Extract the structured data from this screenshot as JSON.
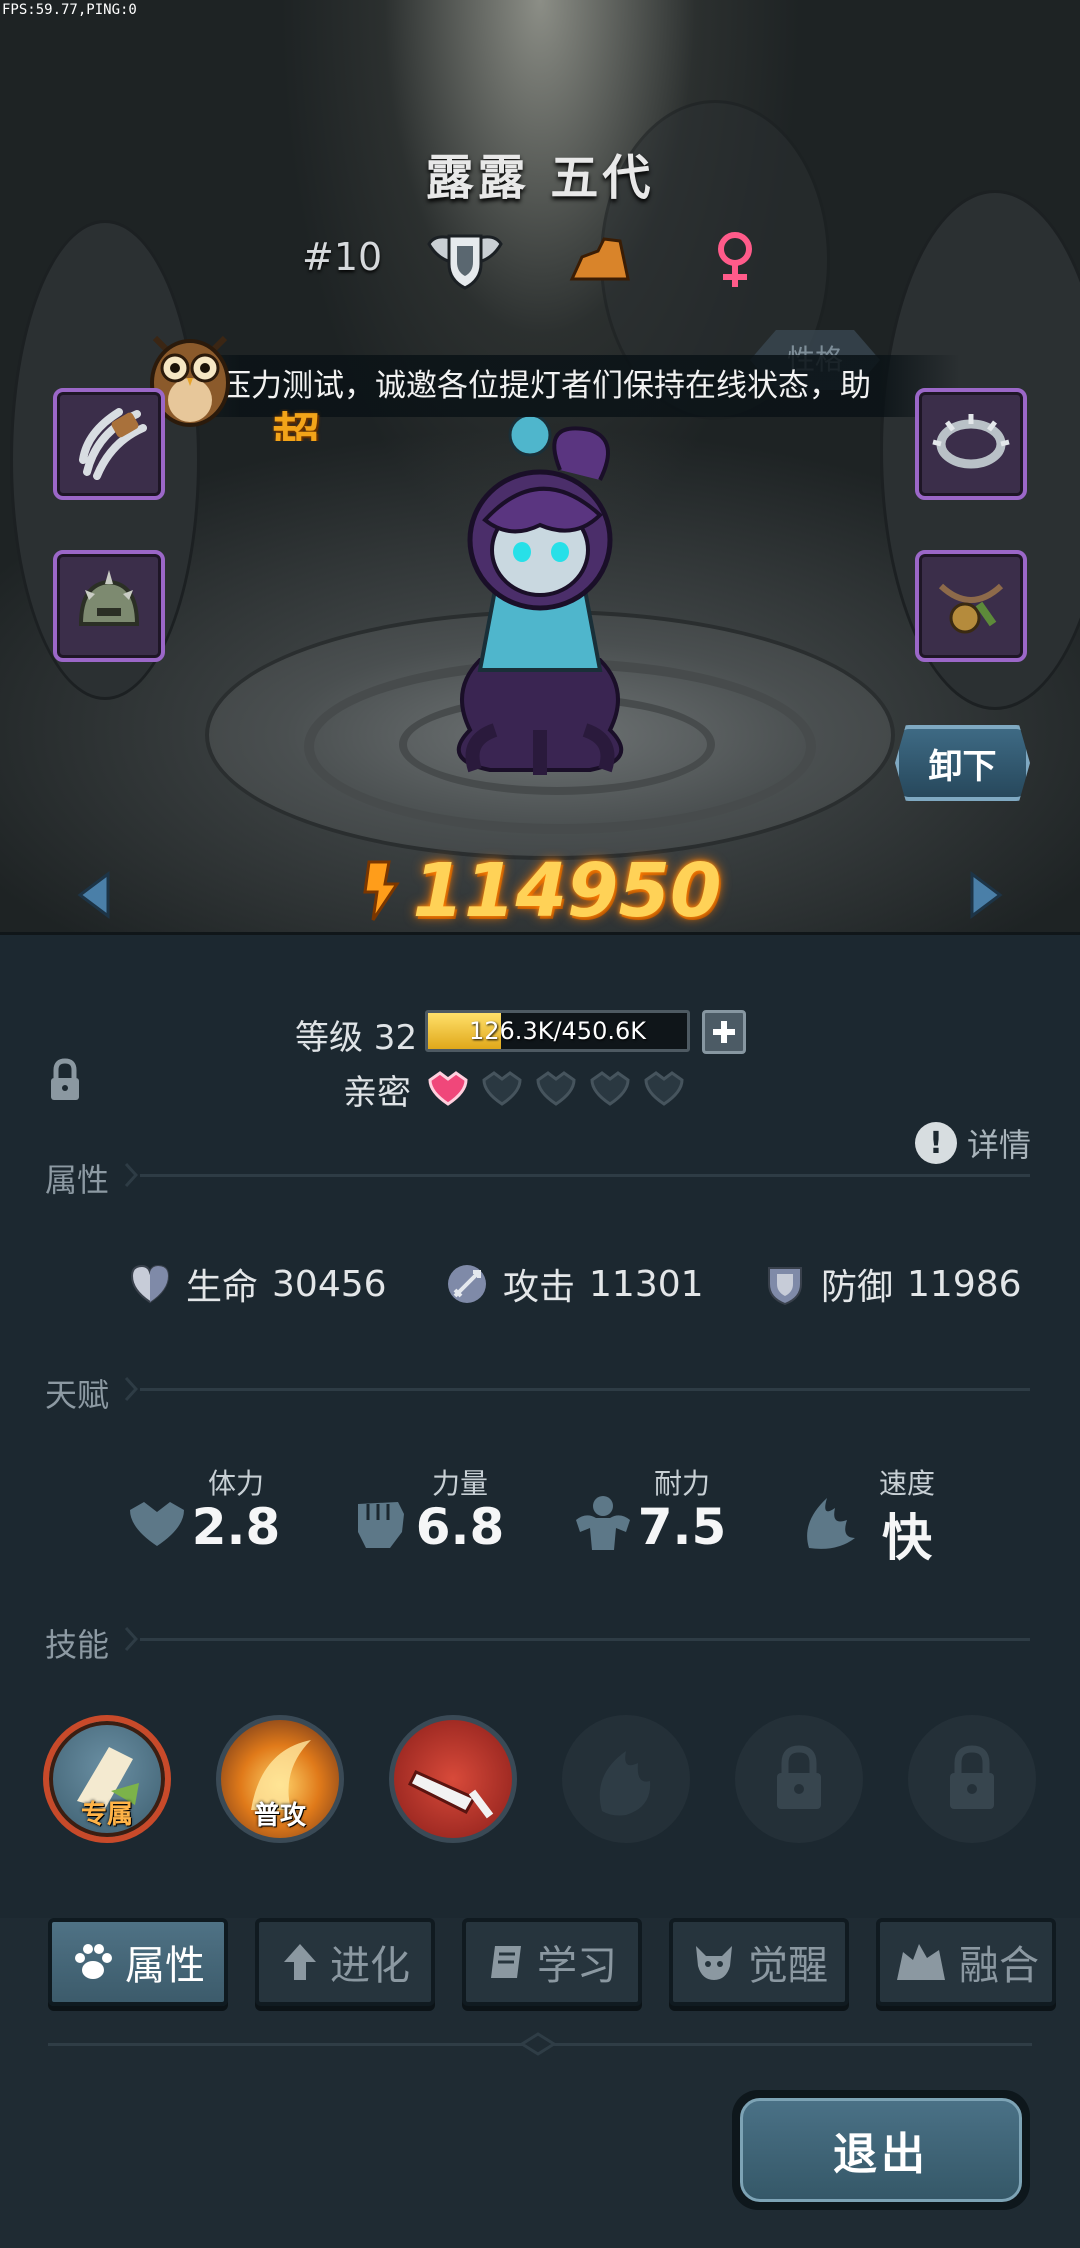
{
  "debug": {
    "fps_text": "FPS:59.77,PING:0"
  },
  "hero": {
    "name": "露露 五代",
    "rank": "#10",
    "rarity_text": "超稀有",
    "power": "114950",
    "level_label": "等级 32",
    "xp_text": "126.3K/450.6K",
    "xp_fraction": 0.28,
    "intimacy_label": "亲密",
    "intimacy_hearts_filled": 1,
    "intimacy_hearts_total": 5
  },
  "notice": {
    "text": "压力测试，诚邀各位提灯者们保持在线状态，助"
  },
  "tag_hex": "性格",
  "buttons": {
    "unequip": "卸下",
    "detail": "详情",
    "exit": "退出"
  },
  "sections": {
    "attributes": "属性",
    "talents": "天赋",
    "skills": "技能"
  },
  "stats": [
    {
      "label": "生命",
      "value": "30456",
      "icon": "heart-shield-icon"
    },
    {
      "label": "攻击",
      "value": "11301",
      "icon": "sword-icon"
    },
    {
      "label": "防御",
      "value": "11986",
      "icon": "shield-icon"
    }
  ],
  "talents": [
    {
      "label": "体力",
      "value": "2.8",
      "icon": "heart-icon"
    },
    {
      "label": "力量",
      "value": "6.8",
      "icon": "fist-icon"
    },
    {
      "label": "耐力",
      "value": "7.5",
      "icon": "muscle-icon"
    },
    {
      "label": "速度",
      "value": "快",
      "icon": "wing-icon"
    }
  ],
  "skills": [
    {
      "label": "专属",
      "state": "active"
    },
    {
      "label": "普攻",
      "state": "active"
    },
    {
      "label": "",
      "state": "active"
    },
    {
      "label": "",
      "state": "inactive"
    },
    {
      "label": "",
      "state": "locked"
    },
    {
      "label": "",
      "state": "locked"
    }
  ],
  "tabs": [
    {
      "label": "属性",
      "icon": "paw-icon",
      "active": true
    },
    {
      "label": "进化",
      "icon": "arrow-up-icon",
      "active": false
    },
    {
      "label": "学习",
      "icon": "book-icon",
      "active": false
    },
    {
      "label": "觉醒",
      "icon": "beast-icon",
      "active": false
    },
    {
      "label": "融合",
      "icon": "merge-icon",
      "active": false
    }
  ],
  "colors": {
    "power": "#ffd257",
    "rarity": "#f3a419",
    "equip_border": "#9b67c8",
    "heart_filled": "#f0477a",
    "panel_bg": "#1c2830"
  }
}
